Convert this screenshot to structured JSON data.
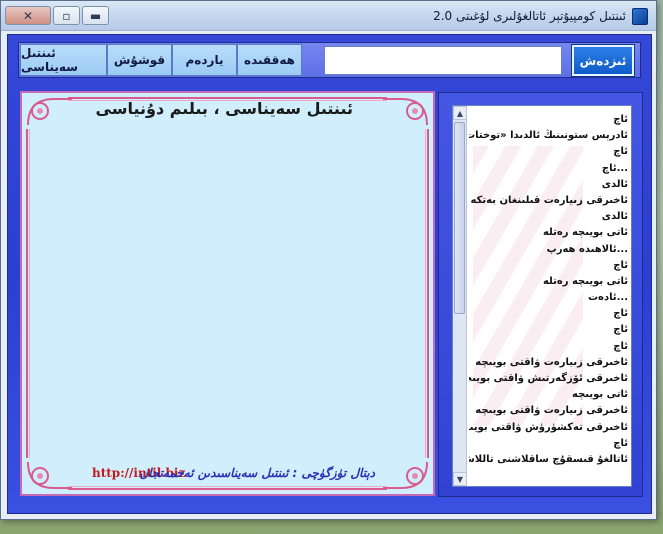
{
  "window": {
    "title": "ئىنتىل كومپيۇتېر ئاتالغۇلىرى لۇغىتى 2.0",
    "close_glyph": "✕",
    "max_glyph": "▫",
    "min_glyph": "▬"
  },
  "toolbar": {
    "menu": [
      {
        "label": "ئىنتىل سەيناسى"
      },
      {
        "label": "قوشۇش"
      },
      {
        "label": "ياردەم"
      },
      {
        "label": "ھەققىدە"
      }
    ],
    "search_value": "",
    "search_button": "ئىزدەش"
  },
  "content": {
    "heading": "ئىنتىل سەيناسى ، بىلىم دۇنياسى",
    "footer_link": "http://intil.biz",
    "footer_credit": "دېتال تۈزگۈچى : ئىنتىل سەيناسىدىن ئەخمەتجان"
  },
  "list": {
    "items": [
      "ئاچ",
      "ئادرېس ستونىنىڭ ئالدىدا «توختات",
      "ئاچ",
      "...ئاچ",
      "ئالدى",
      "ئاخىرقى زىيارەت قىلىنغان بەتكە",
      "ئالدى",
      "ئاتى بويىچە رەتلە",
      "...ئالاھىدە ھەرپ",
      "ئاچ",
      "ئاتى بويىچە رەتلە",
      "...ئادەت",
      "ئاچ",
      "ئاچ",
      "ئاچ",
      "ئاخىرقى زىيارەت ۋاقتى بويىچە",
      "ئاخىرقى ئۆزگەرتىش ۋاقتى بويىچە",
      "ئاتى بويىچە",
      "ئاخىرقى زىيارەت ۋاقتى بويىچە",
      "ئاخىرقى تەكشۈرۈش ۋاقتى بويىچە",
      "ئاچ",
      "ئاتالغۇ قىسقۇچ ساقلاشنى تاللاش"
    ]
  },
  "colors": {
    "accent": "#3548d8",
    "panel_bg": "#d1eefc",
    "ornament": "#d95b8e",
    "link": "#c21a1a"
  }
}
